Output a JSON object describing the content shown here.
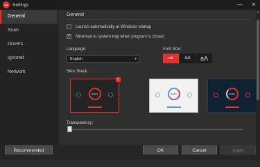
{
  "window": {
    "logo_text": "UF",
    "title": "Settings",
    "minimize_glyph": "—",
    "close_glyph": "✕"
  },
  "sidebar": {
    "items": [
      {
        "label": "General",
        "active": true
      },
      {
        "label": "Scan",
        "active": false
      },
      {
        "label": "Drivers",
        "active": false
      },
      {
        "label": "Ignored",
        "active": false
      },
      {
        "label": "Network",
        "active": false
      }
    ]
  },
  "general": {
    "section_title": "General",
    "launch_startup": {
      "label": "Launch automatically at Windows startup",
      "checked": false
    },
    "minimize_tray": {
      "label": "Minimize to system tray when program is closed",
      "checked": true,
      "check_glyph": "✓"
    }
  },
  "language": {
    "label": "Language:",
    "selected": "English",
    "chevron": "▾"
  },
  "font_size": {
    "label": "Font Size:",
    "options": [
      "aA",
      "aA",
      "aA"
    ],
    "selected_index": 0
  },
  "skin": {
    "label": "Skin: Black",
    "check_glyph": "✓",
    "ring_text": "SCAN",
    "options": [
      "black",
      "white",
      "blue"
    ],
    "selected": "black"
  },
  "transparency": {
    "label": "Transparency:",
    "value_fraction": 0.0
  },
  "footer": {
    "recommended": "Recommended",
    "ok": "OK",
    "cancel": "Cancel",
    "apply": "Apply"
  },
  "colors": {
    "accent": "#e5322d",
    "background": "#2f2f2f",
    "sidebar": "#232323"
  },
  "icons": {
    "app_logo": "app-logo-icon",
    "minimize": "minimize-icon",
    "close": "close-icon",
    "dropdown": "chevron-down-icon",
    "skin_selected": "checkmark-icon"
  }
}
